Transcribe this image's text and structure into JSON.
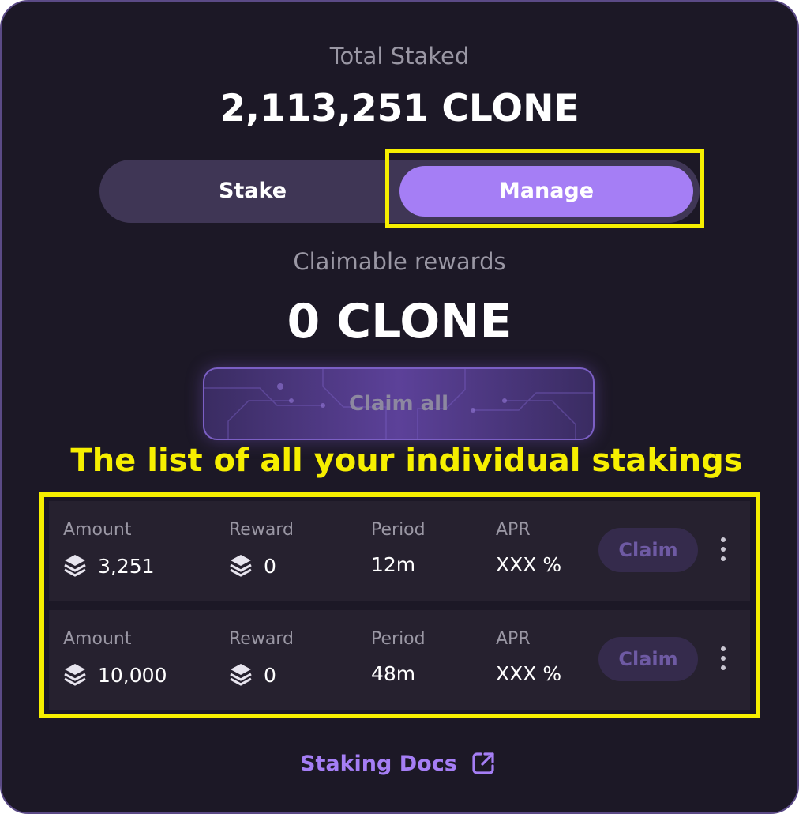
{
  "total": {
    "label": "Total Staked",
    "value": "2,113,251 CLONE"
  },
  "tabs": {
    "stake": "Stake",
    "manage": "Manage",
    "active": "Manage"
  },
  "claimable": {
    "label": "Claimable rewards",
    "value": "0 CLONE"
  },
  "claim_all": {
    "label": "Claim all",
    "enabled": false
  },
  "annotation": {
    "list_note": "The list of all your individual stakings"
  },
  "columns": {
    "amount": "Amount",
    "reward": "Reward",
    "period": "Period",
    "apr": "APR"
  },
  "stakings": [
    {
      "amount": "3,251",
      "reward": "0",
      "period": "12m",
      "apr": "XXX %",
      "claim_label": "Claim"
    },
    {
      "amount": "10,000",
      "reward": "0",
      "period": "48m",
      "apr": "XXX %",
      "claim_label": "Claim"
    }
  ],
  "footer": {
    "docs_label": "Staking Docs",
    "docs_icon": "external-link-icon"
  },
  "colors": {
    "background": "#1c1826",
    "accent": "#a57ef5",
    "highlight": "#f6ef00",
    "row_background": "#26212f"
  }
}
